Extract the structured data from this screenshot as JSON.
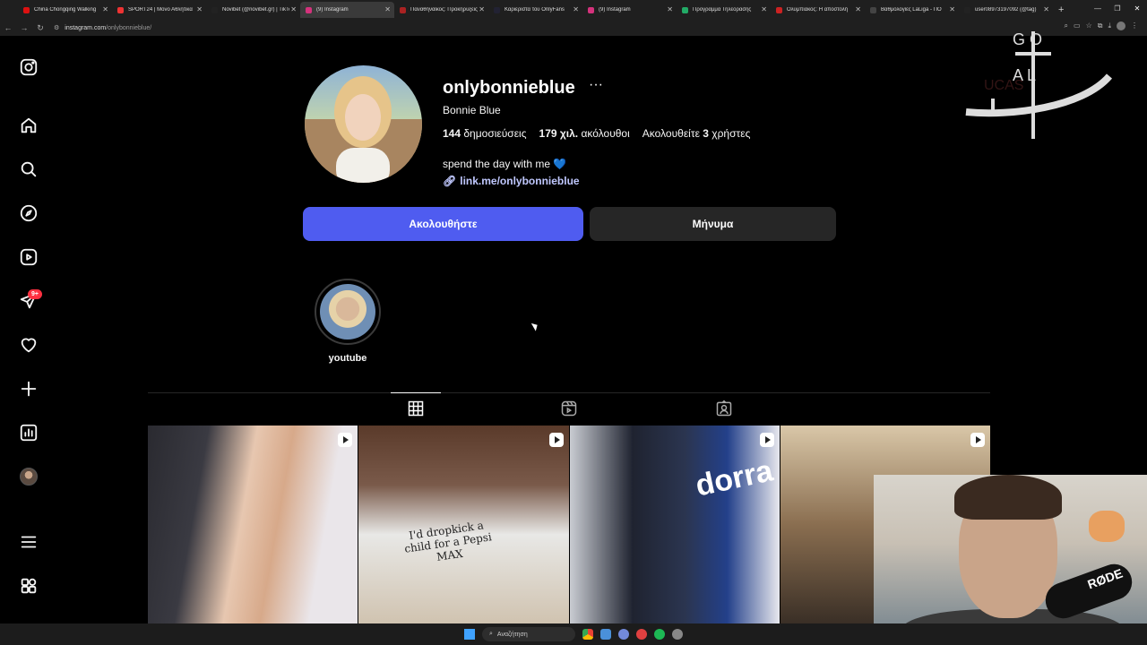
{
  "browser": {
    "tabs": [
      {
        "label": "China Chongqing Walking",
        "color": "#d11"
      },
      {
        "label": "SPORT24 | Μόνο Αθλητικά",
        "color": "#e33"
      },
      {
        "label": "Novibet (@novibet.gr) | TikTok",
        "color": "#222"
      },
      {
        "label": "(9) Instagram",
        "color": "#d4327c",
        "active": true
      },
      {
        "label": "Παναθηναϊκός: Προκηρύξεις",
        "color": "#a22"
      },
      {
        "label": "Καριερίστα του OnlyFans",
        "color": "#223"
      },
      {
        "label": "(9) Instagram",
        "color": "#d4327c"
      },
      {
        "label": "Προγραμμα Τηλεορασης",
        "color": "#2a6"
      },
      {
        "label": "Ολυμπιακός: Η αποστολή",
        "color": "#c22"
      },
      {
        "label": "Βαθμολογίες LaLiga - ΠΟ",
        "color": "#444"
      },
      {
        "label": "user08973197092 (@tag)",
        "color": "#222"
      }
    ],
    "url_host": "instagram.com",
    "url_path": "/onlybonnieblue/"
  },
  "sidebar": {
    "items": [
      {
        "name": "instagram-logo-icon",
        "icon": "instagram"
      },
      {
        "name": "home-icon",
        "icon": "home"
      },
      {
        "name": "search-icon",
        "icon": "search"
      },
      {
        "name": "explore-icon",
        "icon": "explore"
      },
      {
        "name": "reels-icon",
        "icon": "reels"
      },
      {
        "name": "messages-icon",
        "icon": "messages"
      },
      {
        "name": "notifications-icon",
        "icon": "heart"
      },
      {
        "name": "create-icon",
        "icon": "plus"
      },
      {
        "name": "dashboard-icon",
        "icon": "dashboard"
      },
      {
        "name": "profile-avatar",
        "icon": "avatar"
      },
      {
        "name": "menu-icon",
        "icon": "menu"
      },
      {
        "name": "also-from-meta-icon",
        "icon": "apps"
      }
    ],
    "messages_badge": "9+"
  },
  "profile": {
    "username": "onlybonnieblue",
    "more": "···",
    "full_name": "Bonnie Blue",
    "posts_count": "144",
    "posts_label": "δημοσιεύσεις",
    "followers_count": "179 χιλ.",
    "followers_label": "ακόλουθοι",
    "following_label": "Ακολουθείτε",
    "following_count": "3",
    "following_suffix": "χρήστες",
    "bio": "spend the day with me",
    "bio_emoji": "💙",
    "link": "link.me/onlybonnieblue",
    "follow_button": "Ακολουθήστε",
    "message_button": "Μήνυμα"
  },
  "highlights": [
    {
      "label": "youtube"
    }
  ],
  "posts": [
    {
      "type": "reel"
    },
    {
      "type": "reel",
      "shirt_text": "I'd dropkick a child for a Pepsi MAX"
    },
    {
      "type": "reel",
      "overlay_text": "dorra"
    },
    {
      "type": "reel"
    }
  ],
  "watermark": {
    "letters": "G O A L",
    "brand": "UCAS"
  },
  "webcam": {
    "mic_brand": "RØDE"
  },
  "taskbar": {
    "search_placeholder": "Αναζήτηση"
  },
  "colors": {
    "follow": "#4f5cf0",
    "message": "#262626",
    "badge": "#ff3040",
    "link": "#c0c8ff"
  }
}
